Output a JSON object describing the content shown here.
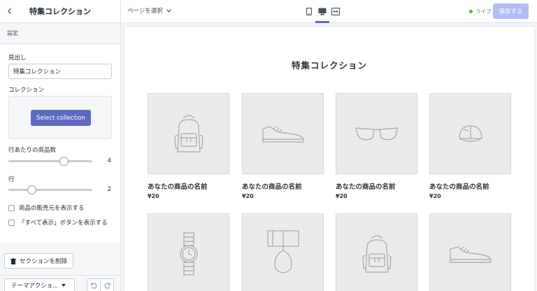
{
  "sidebar": {
    "title": "特集コレクション",
    "section_label": "設定",
    "heading_label": "見出し",
    "heading_value": "特集コレクション",
    "collection_label": "コレクション",
    "select_collection_label": "Select collection",
    "products_per_row_label": "行あたりの商品数",
    "products_per_row_value": "4",
    "rows_label": "行",
    "rows_value": "2",
    "show_vendor_label": "商品の販売元を表示する",
    "show_view_all_label": "「すべて表示」ボタンを表示する",
    "delete_section_label": "セクションを削除",
    "theme_actions_label": "テーマアクショ..."
  },
  "topbar": {
    "page_select_label": "ページを選択",
    "live_label": "ライブ",
    "save_label": "保存する"
  },
  "preview": {
    "title": "特集コレクション",
    "products": [
      {
        "name": "あなたの商品の名前",
        "price": "¥20",
        "icon": "backpack-icon"
      },
      {
        "name": "あなたの商品の名前",
        "price": "¥20",
        "icon": "shoe-icon"
      },
      {
        "name": "あなたの商品の名前",
        "price": "¥20",
        "icon": "sunglasses-icon"
      },
      {
        "name": "あなたの商品の名前",
        "price": "¥20",
        "icon": "cap-icon"
      },
      {
        "name": "",
        "price": "",
        "icon": "watch-icon"
      },
      {
        "name": "",
        "price": "",
        "icon": "lamp-icon"
      },
      {
        "name": "",
        "price": "",
        "icon": "backpack-icon"
      },
      {
        "name": "",
        "price": "",
        "icon": "shoe-icon"
      }
    ]
  },
  "colors": {
    "accent": "#5c6ac4",
    "save_disabled": "#b3bcf5",
    "live_dot": "#50b83c"
  }
}
